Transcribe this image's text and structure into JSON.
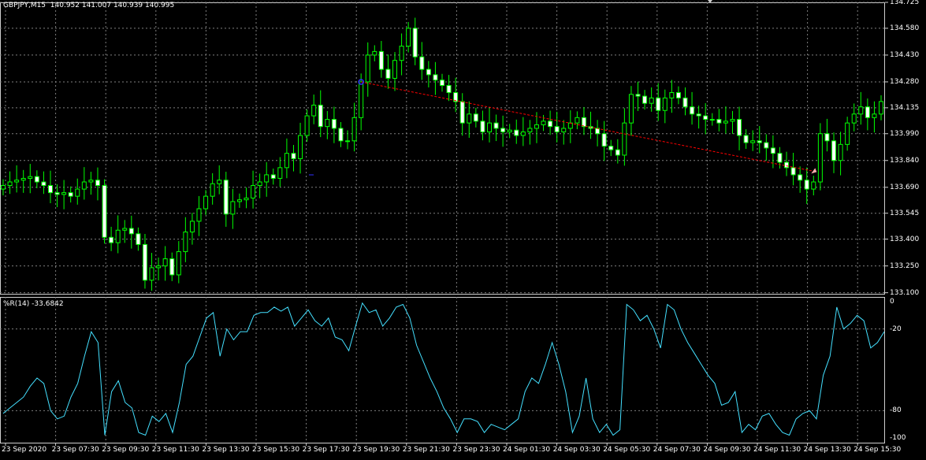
{
  "main_chart": {
    "symbol": "GBPJPY,M15",
    "ohlc_text": "140.952 141.007 140.939 140.995",
    "price_labels": [
      "134.725",
      "134.580",
      "134.430",
      "134.280",
      "134.135",
      "133.990",
      "133.840",
      "133.690",
      "133.545",
      "133.400",
      "133.250",
      "133.100"
    ],
    "price_range": [
      133.094,
      134.725
    ],
    "colors": {
      "background": "#000000",
      "grid": "#7f7f7f",
      "bull": "#00ff00",
      "bear": "#ffffff",
      "trendline": "#ff0000",
      "marker": "#3030ff",
      "arrow": "#ffb0b0"
    }
  },
  "indicator": {
    "name": "%R(14)",
    "value_text": "-33.6842",
    "levels": [
      "0",
      "-20",
      "-80",
      "-100"
    ],
    "range": [
      -100,
      0
    ],
    "line_color": "#44e0ff"
  },
  "time_labels": [
    "23 Sep 2020",
    "23 Sep 07:30",
    "23 Sep 09:30",
    "23 Sep 11:30",
    "23 Sep 13:30",
    "23 Sep 15:30",
    "23 Sep 17:30",
    "23 Sep 19:30",
    "23 Sep 21:30",
    "23 Sep 23:30",
    "24 Sep 01:30",
    "24 Sep 03:30",
    "24 Sep 05:30",
    "24 Sep 07:30",
    "24 Sep 09:30",
    "24 Sep 11:30",
    "24 Sep 13:30",
    "24 Sep 15:30"
  ],
  "chart_data": {
    "type": "candlestick",
    "bar_count": 131,
    "candles_close": [
      133.7,
      133.72,
      133.73,
      133.74,
      133.75,
      133.72,
      133.7,
      133.66,
      133.65,
      133.66,
      133.64,
      133.68,
      133.72,
      133.73,
      133.7,
      133.41,
      133.38,
      133.45,
      133.46,
      133.43,
      133.37,
      133.17,
      133.24,
      133.25,
      133.29,
      133.2,
      133.33,
      133.44,
      133.5,
      133.57,
      133.64,
      133.71,
      133.73,
      133.54,
      133.61,
      133.62,
      133.63,
      133.7,
      133.72,
      133.76,
      133.74,
      133.8,
      133.88,
      133.85,
      133.98,
      134.09,
      134.15,
      134.03,
      134.07,
      134.02,
      133.95,
      133.95,
      134.08,
      134.28,
      134.43,
      134.45,
      134.35,
      134.3,
      134.4,
      134.48,
      134.58,
      134.42,
      134.35,
      134.32,
      134.29,
      134.26,
      134.22,
      134.17,
      134.05,
      134.1,
      134.06,
      134.0,
      134.05,
      134.02,
      134.0,
      134.01,
      133.98,
      134.0,
      134.02,
      134.04,
      134.06,
      134.03,
      134.0,
      134.02,
      134.05,
      134.08,
      134.03,
      134.02,
      133.99,
      133.92,
      133.9,
      133.87,
      134.05,
      134.21,
      134.2,
      134.16,
      134.19,
      134.12,
      134.19,
      134.22,
      134.19,
      134.14,
      134.1,
      134.09,
      134.07,
      134.07,
      134.05,
      134.06,
      134.07,
      133.98,
      133.94,
      133.95,
      133.94,
      133.91,
      133.88,
      133.83,
      133.8,
      133.76,
      133.73,
      133.68,
      133.72,
      133.99,
      133.95,
      133.84,
      133.93,
      134.05,
      134.1,
      134.14,
      134.08,
      134.1,
      134.17
    ],
    "trendline": {
      "from_bar": 53,
      "from_price": 134.28,
      "to_bar": 120,
      "to_price": 133.78
    },
    "williams_r": [
      -82,
      -78,
      -74,
      -70,
      -62,
      -56,
      -60,
      -80,
      -86,
      -84,
      -70,
      -60,
      -40,
      -22,
      -30,
      -98,
      -66,
      -58,
      -74,
      -78,
      -96,
      -98,
      -84,
      -88,
      -82,
      -96,
      -74,
      -46,
      -40,
      -26,
      -12,
      -8,
      -40,
      -20,
      -28,
      -22,
      -22,
      -10,
      -8,
      -8,
      -4,
      -7,
      -4,
      -18,
      -12,
      -6,
      -14,
      -18,
      -12,
      -26,
      -28,
      -36,
      -18,
      -1,
      -8,
      -6,
      -18,
      -12,
      -4,
      -2,
      -12,
      -32,
      -44,
      -56,
      -66,
      -78,
      -86,
      -96,
      -86,
      -86,
      -88,
      -96,
      -90,
      -92,
      -94,
      -90,
      -86,
      -66,
      -56,
      -60,
      -46,
      -30,
      -46,
      -66,
      -96,
      -84,
      -56,
      -86,
      -96,
      -90,
      -98,
      -94,
      -2,
      -6,
      -14,
      -10,
      -20,
      -34,
      -2,
      -6,
      -20,
      -30,
      -38,
      -46,
      -54,
      -60,
      -76,
      -74,
      -66,
      -96,
      -90,
      -94,
      -84,
      -82,
      -90,
      -96,
      -98,
      -86,
      -82,
      -80,
      -86,
      -54,
      -40,
      -4,
      -20,
      -16,
      -10,
      -14,
      -34,
      -30,
      -22
    ]
  }
}
